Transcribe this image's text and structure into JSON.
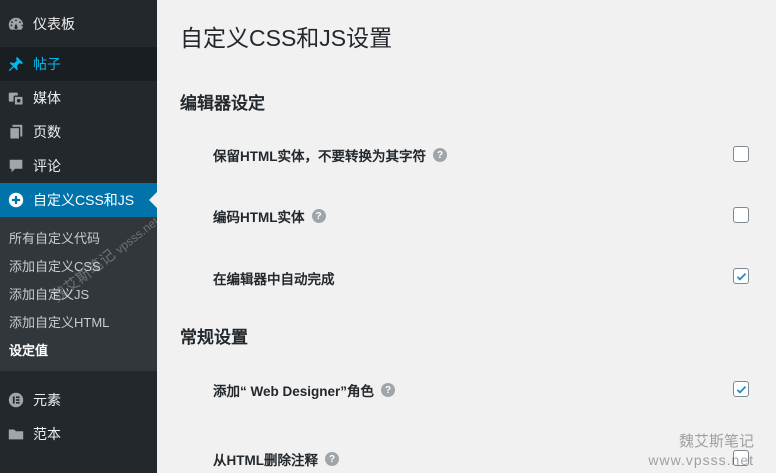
{
  "sidebar": {
    "items": [
      {
        "label": "仪表板",
        "icon": "dashboard-icon"
      },
      {
        "label": "帖子",
        "icon": "pin-icon"
      },
      {
        "label": "媒体",
        "icon": "media-icon"
      },
      {
        "label": "页数",
        "icon": "pages-icon"
      },
      {
        "label": "评论",
        "icon": "comment-icon"
      },
      {
        "label": "自定义CSS和JS",
        "icon": "plus-circle-icon"
      }
    ],
    "submenu": [
      "所有自定义代码",
      "添加自定义CSS",
      "添加自定义JS",
      "添加自定义HTML",
      "设定值"
    ],
    "bottom_items": [
      {
        "label": "元素",
        "icon": "elementor-icon"
      },
      {
        "label": "范本",
        "icon": "folder-icon"
      }
    ]
  },
  "main": {
    "title": "自定义CSS和JS设置",
    "sections": [
      {
        "title": "编辑器设定"
      },
      {
        "title": "常规设置"
      }
    ],
    "rows": [
      {
        "label": "保留HTML实体，不要转换为其字符",
        "help": true,
        "checked": false
      },
      {
        "label": "编码HTML实体",
        "help": true,
        "checked": false
      },
      {
        "label": "在编辑器中自动完成",
        "help": false,
        "checked": true
      },
      {
        "label": "添加“ Web Designer”角色",
        "help": true,
        "checked": true
      },
      {
        "label": "从HTML删除注释",
        "help": true,
        "checked": false
      }
    ]
  },
  "watermarks": {
    "side_text": "魏艾斯笔记",
    "side_url": "vpsss.net",
    "corner_text": "魏艾斯笔记",
    "corner_url": "www.vpsss.net"
  },
  "colors": {
    "sidebar_bg": "#23282d",
    "current_bg": "#0073aa",
    "posts_color": "#00b9eb",
    "checkmark": "#1e8cbe"
  }
}
